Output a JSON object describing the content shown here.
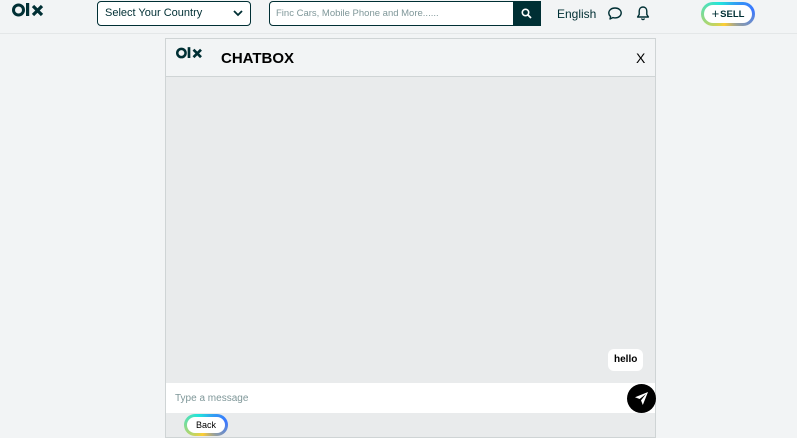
{
  "header": {
    "country_select": {
      "value": "Select Your Country"
    },
    "search": {
      "placeholder": "Finc Cars, Mobile Phone and More......"
    },
    "language": "English",
    "sell_label": "SELL",
    "sell_plus": "+"
  },
  "chat": {
    "title": "CHATBOX",
    "close_label": "X",
    "messages": [
      {
        "text": "hello",
        "from": "me"
      }
    ],
    "input_placeholder": "Type a message",
    "back_label": "Back"
  },
  "icons": {
    "logo": "olx-logo",
    "country_dropdown": "chevron-down-icon",
    "search": "search-icon",
    "chat": "chat-bubble-icon",
    "notifications": "bell-icon",
    "send": "paper-plane-icon"
  },
  "colors": {
    "brand_dark": "#002f34",
    "page_bg": "#f2f4f5",
    "chat_area_bg": "#e9ebec",
    "gradient_yellow": "#ffce32",
    "gradient_teal": "#23e5db",
    "gradient_blue": "#3a77ff"
  }
}
